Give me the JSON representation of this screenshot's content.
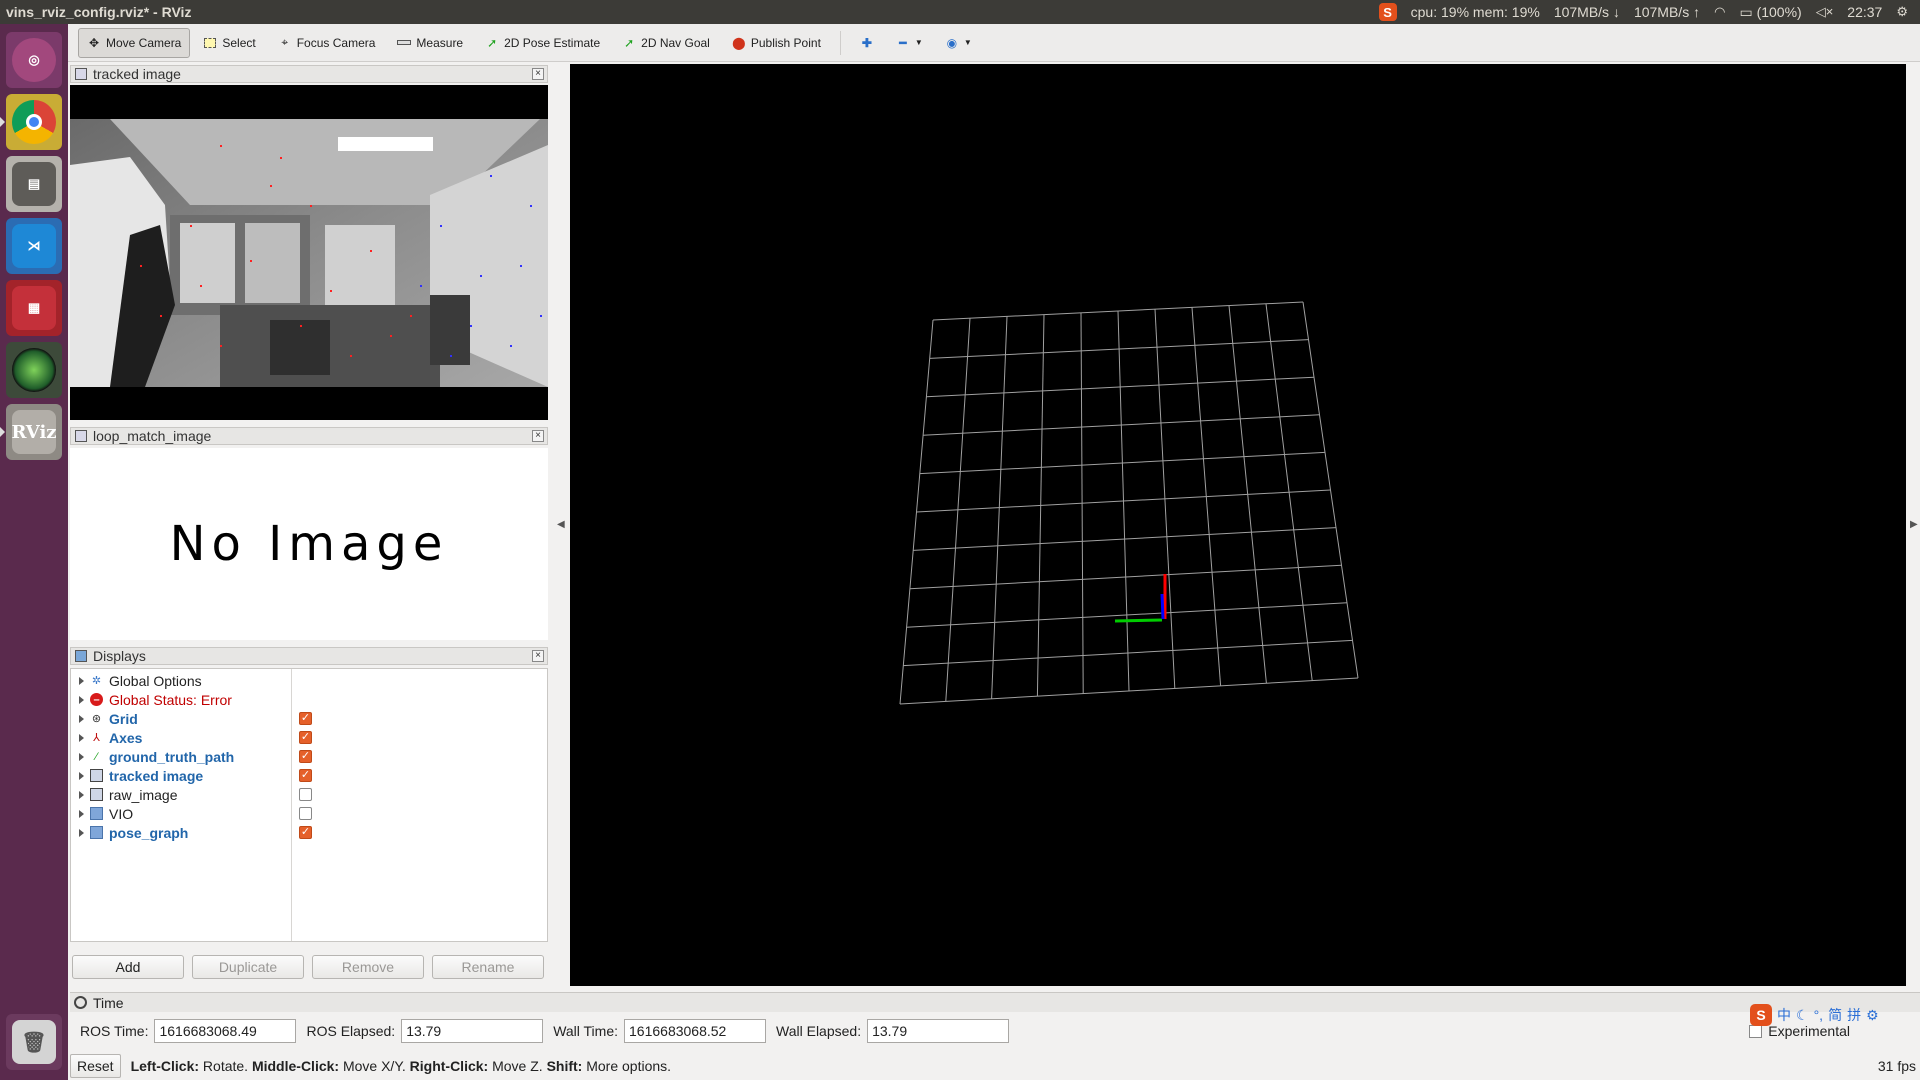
{
  "window": {
    "title": "vins_rviz_config.rviz* - RViz"
  },
  "indicators": {
    "sogou": "S",
    "cpu_mem": "cpu: 19% mem: 19%",
    "down": "107MB/s",
    "up": "107MB/s",
    "battery": "(100%)",
    "clock": "22:37"
  },
  "launcher": {
    "items": [
      "ubuntu-dash",
      "chrome",
      "files",
      "vscode",
      "app-red",
      "camera",
      "rviz"
    ],
    "rviz_label": "RViz",
    "trash": "trash"
  },
  "toolbar": {
    "tools": [
      {
        "label": "Move Camera",
        "icon": "move-camera-icon",
        "active": true
      },
      {
        "label": "Select",
        "icon": "select-icon"
      },
      {
        "label": "Focus Camera",
        "icon": "focus-camera-icon"
      },
      {
        "label": "Measure",
        "icon": "measure-icon"
      },
      {
        "label": "2D Pose Estimate",
        "icon": "pose-estimate-icon"
      },
      {
        "label": "2D Nav Goal",
        "icon": "nav-goal-icon"
      },
      {
        "label": "Publish Point",
        "icon": "publish-point-icon"
      }
    ]
  },
  "panels": {
    "tracked_image": {
      "title": "tracked image"
    },
    "loop_match_image": {
      "title": "loop_match_image",
      "placeholder": "No Image"
    },
    "displays": {
      "title": "Displays"
    }
  },
  "displays": {
    "items": [
      {
        "label": "Global Options",
        "icon": "gear-icon",
        "style": "normal",
        "checkbox": null
      },
      {
        "label": "Global Status: Error",
        "icon": "error-icon",
        "style": "error",
        "checkbox": null
      },
      {
        "label": "Grid",
        "icon": "grid-icon",
        "style": "bold",
        "checkbox": true
      },
      {
        "label": "Axes",
        "icon": "axes-icon",
        "style": "bold",
        "checkbox": true
      },
      {
        "label": "ground_truth_path",
        "icon": "path-icon",
        "style": "bold",
        "checkbox": true
      },
      {
        "label": "tracked image",
        "icon": "image-icon",
        "style": "bold",
        "checkbox": true
      },
      {
        "label": "raw_image",
        "icon": "image-icon",
        "style": "normal",
        "checkbox": false
      },
      {
        "label": "VIO",
        "icon": "folder-icon",
        "style": "normal",
        "checkbox": false
      },
      {
        "label": "pose_graph",
        "icon": "folder-icon",
        "style": "bold",
        "checkbox": true
      }
    ],
    "buttons": {
      "add": "Add",
      "duplicate": "Duplicate",
      "remove": "Remove",
      "rename": "Rename"
    }
  },
  "time": {
    "title": "Time",
    "ros_time_label": "ROS Time:",
    "ros_time": "1616683068.49",
    "ros_elapsed_label": "ROS Elapsed:",
    "ros_elapsed": "13.79",
    "wall_time_label": "Wall Time:",
    "wall_time": "1616683068.52",
    "wall_elapsed_label": "Wall Elapsed:",
    "wall_elapsed": "13.79",
    "experimental_label": "Experimental"
  },
  "ime": {
    "s": "S",
    "zh": "中",
    "simplified": "简",
    "pinyin": "拼"
  },
  "status": {
    "reset": "Reset",
    "left_click_key": "Left-Click:",
    "left_click": "Rotate.",
    "middle_click_key": "Middle-Click:",
    "middle_click": "Move X/Y.",
    "right_click_key": "Right-Click:",
    "right_click": "Move Z.",
    "shift_key": "Shift:",
    "shift": "More options.",
    "fps": "31 fps"
  },
  "colors": {
    "launcher_bg": "#5a2a4d",
    "grid_line": "#a0a0a0",
    "axis_x": "#ff0000",
    "axis_y": "#00cc00",
    "axis_z": "#0000ff",
    "checkbox_on": "#e5602a"
  }
}
